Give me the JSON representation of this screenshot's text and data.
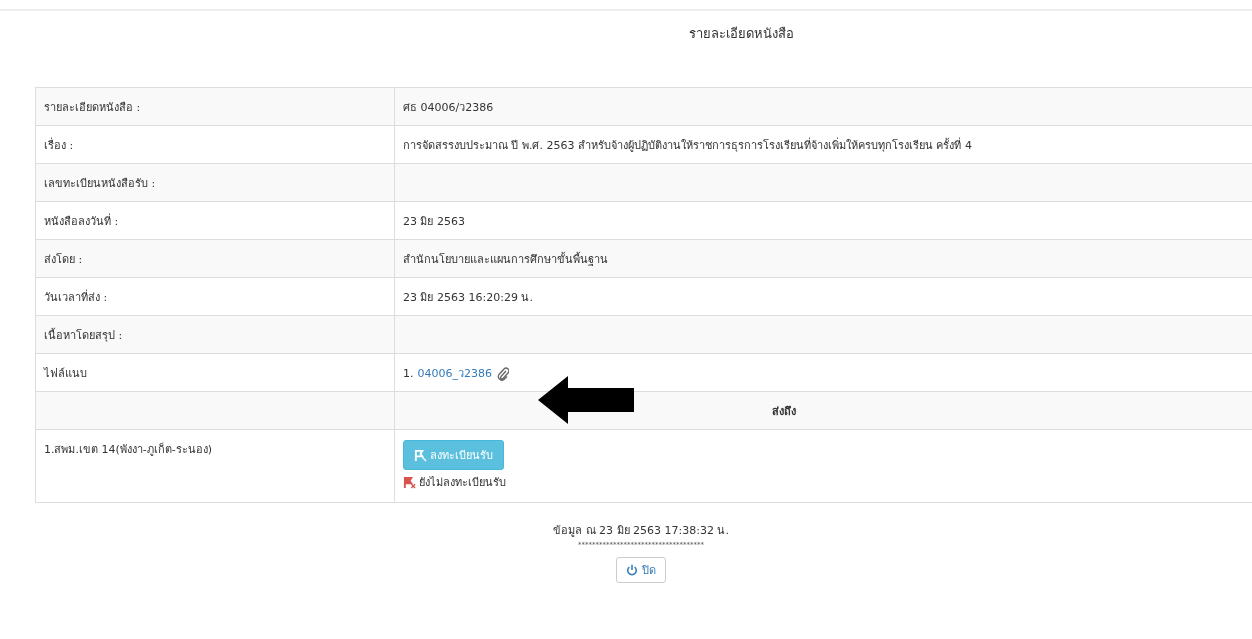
{
  "page_title": "รายละเอียดหนังสือ",
  "details": [
    {
      "kind": "text",
      "label": "รายละเอียดหนังสือ :",
      "value": "ศธ 04006/ว2386"
    },
    {
      "kind": "text",
      "label": "เรื่อง :",
      "value": "การจัดสรรงบประมาณ ปี พ.ศ. 2563 สำหรับจ้างผู้ปฏิบัติงานให้ราชการธุรการโรงเรียนที่จ้างเพิ่มให้ครบทุกโรงเรียน ครั้งที่ 4"
    },
    {
      "kind": "text",
      "label": "เลขทะเบียนหนังสือรับ :"
    },
    {
      "kind": "text",
      "label": "หนังสือลงวันที่ :",
      "value": "23 มิย 2563"
    },
    {
      "kind": "text",
      "label": "ส่งโดย :",
      "value": "สำนักนโยบายและแผนการศึกษาขั้นพื้นฐาน"
    },
    {
      "kind": "text",
      "label": "วันเวลาที่ส่ง :",
      "value": "23 มิย 2563 16:20:29 น."
    },
    {
      "kind": "text",
      "label": "เนื้อหาโดยสรุป :"
    },
    {
      "kind": "attachment",
      "label": "ไฟล์แนบ",
      "number": "1.",
      "link": "04006_ว2386"
    }
  ],
  "recipients_header": "ส่งถึง",
  "recipients": [
    {
      "name": "1.สพม.เขต 14(พังงา-ภูเก็ต-ระนอง)",
      "button": "ลงทะเบียนรับ",
      "status": "ยังไม่ลงทะเบียนรับ"
    }
  ],
  "footer": {
    "timestamp": "ข้อมูล ณ 23 มิย 2563 17:38:32 น.",
    "separator": "************************************",
    "close_button": "ปิด"
  }
}
